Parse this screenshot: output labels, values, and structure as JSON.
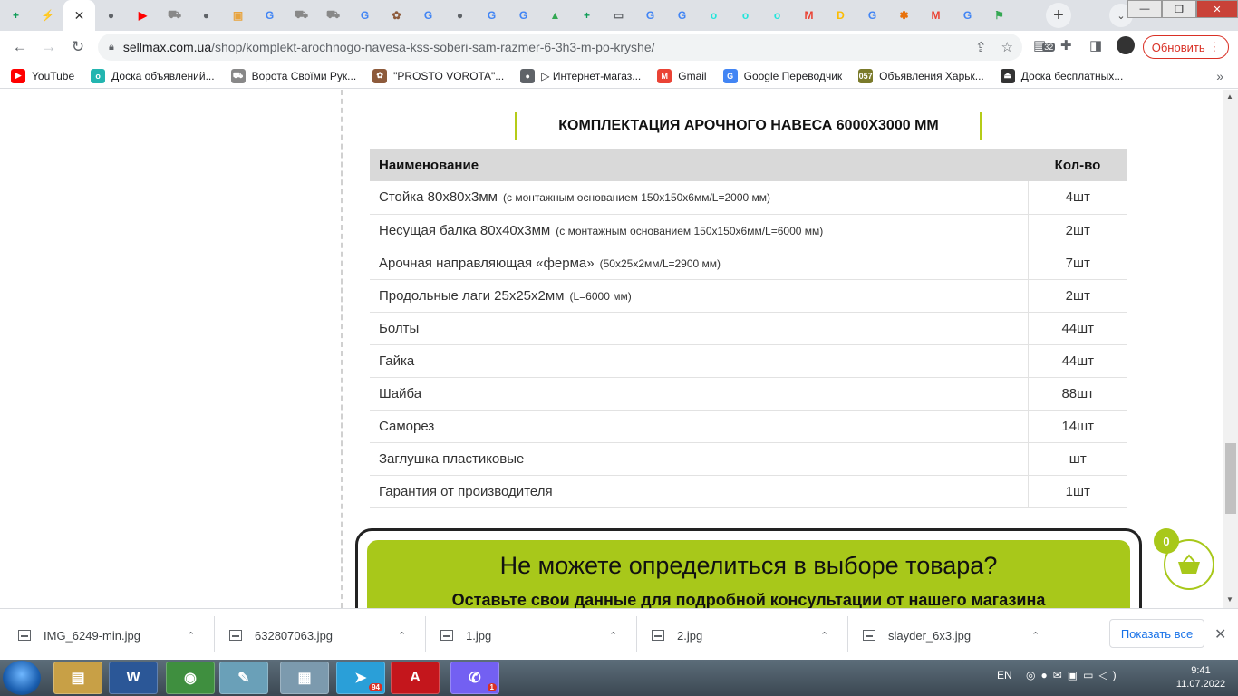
{
  "browser": {
    "tabs": [
      {
        "icon": "sheets-icon",
        "color": "#0f9d58"
      },
      {
        "icon": "lightning-icon",
        "color": "#f4b400"
      },
      {
        "icon": "close-icon",
        "color": "#ffffff",
        "active": true
      },
      {
        "icon": "globe-icon",
        "color": "#5f6368"
      },
      {
        "icon": "youtube-icon",
        "color": "#ff0000"
      },
      {
        "icon": "cart-icon",
        "color": "#888888"
      },
      {
        "icon": "globe-icon",
        "color": "#5f6368"
      },
      {
        "icon": "image-icon",
        "color": "#e8a33d"
      },
      {
        "icon": "google-icon",
        "color": "#4285f4"
      },
      {
        "icon": "cart-icon",
        "color": "#888888"
      },
      {
        "icon": "cart-icon",
        "color": "#888888"
      },
      {
        "icon": "google-icon",
        "color": "#4285f4"
      },
      {
        "icon": "gear-badge-icon",
        "color": "#8d5a3b"
      },
      {
        "icon": "google-icon",
        "color": "#4285f4"
      },
      {
        "icon": "globe-icon",
        "color": "#5f6368"
      },
      {
        "icon": "google-icon",
        "color": "#4285f4"
      },
      {
        "icon": "google-icon",
        "color": "#4285f4"
      },
      {
        "icon": "drive-icon",
        "color": "#34a853"
      },
      {
        "icon": "sheets-icon",
        "color": "#0f9d58"
      },
      {
        "icon": "card-icon",
        "color": "#5f6368"
      },
      {
        "icon": "google-icon",
        "color": "#4285f4"
      },
      {
        "icon": "google-icon",
        "color": "#4285f4"
      },
      {
        "icon": "olx-icon",
        "color": "#23e5db"
      },
      {
        "icon": "olx-icon",
        "color": "#23e5db"
      },
      {
        "icon": "olx-icon",
        "color": "#23e5db"
      },
      {
        "icon": "gmail-icon",
        "color": "#ea4335"
      },
      {
        "icon": "d-icon",
        "color": "#fbbc04"
      },
      {
        "icon": "google-icon",
        "color": "#4285f4"
      },
      {
        "icon": "paw-icon",
        "color": "#e8710a"
      },
      {
        "icon": "gmail-icon",
        "color": "#ea4335"
      },
      {
        "icon": "google-icon",
        "color": "#4285f4"
      },
      {
        "icon": "maps-icon",
        "color": "#34a853"
      }
    ],
    "url_host": "sellmax.com.ua",
    "url_path": "/shop/komplekt-arochnogo-navesa-kss-soberi-sam-razmer-6-3h3-m-po-kryshe/",
    "update_label": "Обновить",
    "extension_badge": "32",
    "bookmarks": [
      {
        "label": "YouTube",
        "icon": "youtube-icon",
        "color": "#ff0000"
      },
      {
        "label": "Доска объявлений...",
        "icon": "olx-icon",
        "color": "#23b5b0"
      },
      {
        "label": "Ворота Своїми Рук...",
        "icon": "cart-icon",
        "color": "#888888"
      },
      {
        "label": "\"PROSTO VOROTA\"...",
        "icon": "gear-badge-icon",
        "color": "#8d5a3b"
      },
      {
        "label": "▷ Интернет-магаз...",
        "icon": "globe-icon",
        "color": "#5f6368"
      },
      {
        "label": "Gmail",
        "icon": "gmail-icon",
        "color": "#ea4335"
      },
      {
        "label": "Google Переводчик",
        "icon": "translate-icon",
        "color": "#4285f4"
      },
      {
        "label": "Объявления Харьк...",
        "icon": "057-icon",
        "color": "#7a7a2a"
      },
      {
        "label": "Доска бесплатных...",
        "icon": "tower-icon",
        "color": "#333333"
      }
    ]
  },
  "page": {
    "section_title": "КОМПЛЕКТАЦИЯ АРОЧНОГО НАВЕСА 6000Х3000 ММ",
    "table": {
      "headers": {
        "name": "Наименование",
        "qty": "Кол-во"
      },
      "rows": [
        {
          "name": "Стойка 80х80х3мм",
          "note": "(с монтажным основанием 150х150х6мм/L=2000 мм)",
          "qty": "4шт"
        },
        {
          "name": "Несущая балка 80х40х3мм",
          "note": "(с монтажным основанием 150х150х6мм/L=6000 мм)",
          "qty": "2шт"
        },
        {
          "name": "Арочная направляющая «ферма»",
          "note": "(50х25х2мм/L=2900 мм)",
          "qty": "7шт"
        },
        {
          "name": "Продольные лаги 25х25х2мм",
          "note": "(L=6000 мм)",
          "qty": "2шт"
        },
        {
          "name": "Болты",
          "note": "",
          "qty": "44шт"
        },
        {
          "name": "Гайка",
          "note": "",
          "qty": "44шт"
        },
        {
          "name": "Шайба",
          "note": "",
          "qty": "88шт"
        },
        {
          "name": "Саморез",
          "note": "",
          "qty": "14шт"
        },
        {
          "name": "Заглушка пластиковые",
          "note": "",
          "qty": "шт"
        },
        {
          "name": "Гарантия от производителя",
          "note": "",
          "qty": "1шт"
        }
      ]
    },
    "cta": {
      "title": "Не можете определиться в выборе товара?",
      "subtitle": "Оставьте свои данные для подробной консультации от нашего магазина"
    },
    "cart_count": "0"
  },
  "downloads": {
    "items": [
      "IMG_6249-min.jpg",
      "632807063.jpg",
      "1.jpg",
      "2.jpg",
      "slayder_6x3.jpg"
    ],
    "show_all": "Показать все"
  },
  "taskbar": {
    "apps": [
      {
        "name": "explorer",
        "glyph": "▤"
      },
      {
        "name": "word",
        "glyph": "W"
      },
      {
        "name": "chrome",
        "glyph": "◉"
      },
      {
        "name": "notepad",
        "glyph": "✎"
      },
      {
        "name": "calculator",
        "glyph": "▦"
      },
      {
        "name": "telegram",
        "glyph": "➤"
      },
      {
        "name": "acrobat",
        "glyph": "A"
      },
      {
        "name": "viber",
        "glyph": "✆"
      }
    ],
    "telegram_badge": "94",
    "viber_badge": "1",
    "language": "EN",
    "time": "9:41",
    "date": "11.07.2022"
  },
  "colors": {
    "accent": "#a8c81a",
    "update_red": "#d93025",
    "link_blue": "#1a73e8"
  }
}
